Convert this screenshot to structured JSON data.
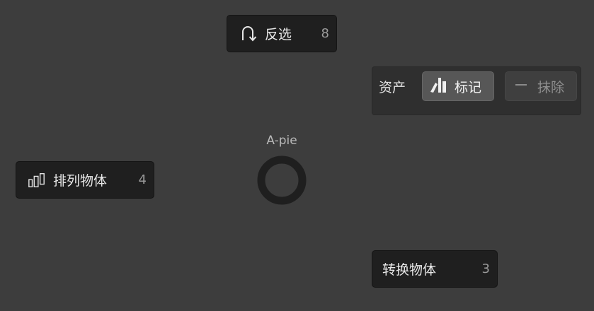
{
  "pie_menu": {
    "title": "A-pie",
    "items": {
      "invert": {
        "label": "反选",
        "hotkey": "8",
        "icon": "select-invert-icon"
      },
      "arrange": {
        "label": "排列物体",
        "hotkey": "4",
        "icon": "arrange-bars-icon"
      },
      "convert": {
        "label": "转换物体",
        "hotkey": "3"
      }
    },
    "asset_panel": {
      "label": "资产",
      "mark_button": {
        "label": "标记",
        "icon": "asset-mark-icon"
      },
      "clear_button": {
        "label": "抹除",
        "icon": "minus-icon"
      }
    }
  }
}
